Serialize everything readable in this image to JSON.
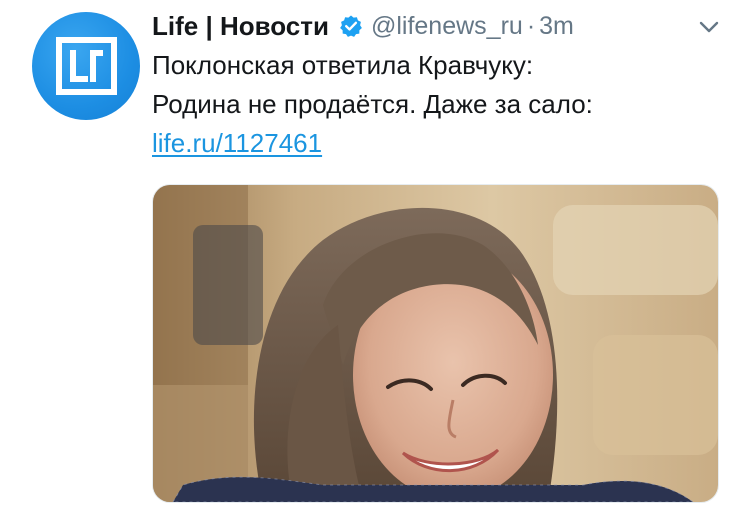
{
  "tweet": {
    "display_name": "Life | Новости",
    "handle": "@lifenews_ru",
    "separator": "·",
    "time": "3m",
    "text_line1": "Поклонская ответила Кравчуку:",
    "text_line2": "Родина не продаётся. Даже за сало:",
    "link": "life.ru/1127461"
  },
  "icons": {
    "avatar": "life-logo-icon",
    "verified": "verified-badge-icon",
    "menu": "chevron-down-icon"
  },
  "colors": {
    "link": "#1b95e0",
    "secondary_text": "#657786",
    "verified": "#1da1f2",
    "avatar_bg": "#1d8ee3"
  }
}
